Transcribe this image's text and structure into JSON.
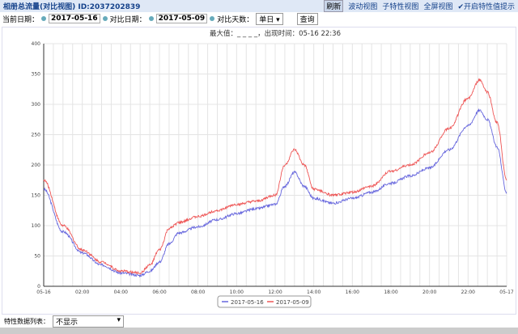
{
  "header": {
    "title": "相册总流量(对比视图) ID:2037202839",
    "refresh": "刷新",
    "links": [
      "波动视图",
      "子特性视图",
      "全屏视图"
    ],
    "toggle": "✔开启特性值提示"
  },
  "toolbar": {
    "current_label": "当前日期：",
    "current_date": "2017-05-16",
    "compare_label": "对比日期：",
    "compare_date": "2017-05-09",
    "days_label": "对比天数：",
    "days_value": "单日",
    "query": "查询"
  },
  "footer": {
    "label": "特性数据列表：",
    "value": "不显示"
  },
  "chart_data": {
    "type": "line",
    "title": "最大值：_ _ _ _，出现时间：05-16 22:36",
    "xlim": [
      0,
      24
    ],
    "ylim": [
      0,
      400
    ],
    "yticks": [
      0,
      50,
      100,
      150,
      200,
      250,
      300,
      350,
      400
    ],
    "xtick_labels": [
      "05-16",
      "02:00",
      "04:00",
      "06:00",
      "08:00",
      "10:00",
      "12:00",
      "14:00",
      "16:00",
      "18:00",
      "20:00",
      "22:00",
      "05-17"
    ],
    "series": [
      {
        "name": "2017-05-16",
        "color": "#6666dd",
        "x": [
          0,
          1,
          2,
          3,
          4,
          5,
          5.5,
          6,
          6.5,
          7,
          8,
          9,
          10,
          11,
          12,
          12.5,
          13,
          13.5,
          14,
          15,
          16,
          17,
          18,
          19,
          20,
          21,
          22,
          22.6,
          23,
          23.5,
          24
        ],
        "y": [
          160,
          90,
          55,
          35,
          22,
          18,
          25,
          40,
          70,
          88,
          98,
          110,
          120,
          128,
          135,
          165,
          188,
          165,
          145,
          137,
          145,
          155,
          170,
          182,
          195,
          225,
          265,
          290,
          275,
          230,
          155
        ]
      },
      {
        "name": "2017-05-09",
        "color": "#ee5555",
        "x": [
          0,
          1,
          2,
          3,
          4,
          5,
          5.5,
          6,
          6.5,
          7,
          8,
          9,
          10,
          11,
          12,
          12.5,
          13,
          13.5,
          14,
          15,
          16,
          17,
          18,
          19,
          20,
          21,
          22,
          22.6,
          23,
          23.5,
          24
        ],
        "y": [
          175,
          100,
          60,
          40,
          25,
          22,
          35,
          60,
          95,
          105,
          115,
          125,
          135,
          140,
          150,
          200,
          225,
          200,
          160,
          150,
          155,
          165,
          190,
          200,
          220,
          260,
          310,
          340,
          320,
          270,
          175
        ]
      }
    ]
  }
}
